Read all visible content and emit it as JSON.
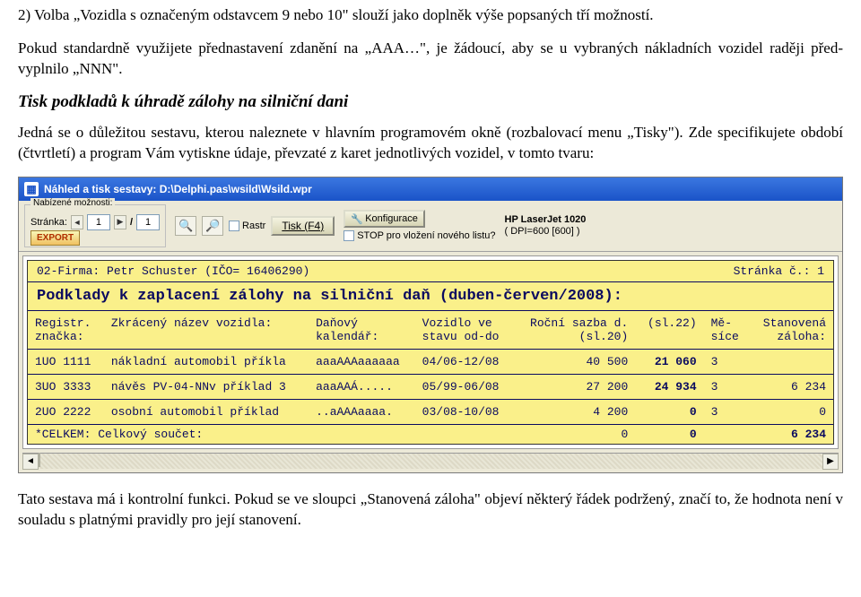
{
  "doc": {
    "item_num": "2)",
    "item_text": "Volba „Vozidla s označeným odstavcem 9 nebo 10\" slouží jako doplněk výše popsaných tří možností.",
    "para1": "Pokud standardně využijete přednastavení zdanění na „AAA…\", je žádoucí, aby se u vybraných nákladních vozidel raději před-vyplnilo „NNN\".",
    "heading": "Tisk podkladů k úhradě zálohy na silniční dani",
    "para2": "Jedná se o důležitou sestavu, kterou naleznete v hlavním programovém okně (rozbalovací menu „Tisky\"). Zde specifikujete období (čtvrtletí) a program Vám vytiskne údaje, převzaté z karet jednotlivých vozidel, v tomto tvaru:",
    "para3": "Tato sestava má i kontrolní funkci. Pokud se ve sloupci „Stanovená záloha\" objeví některý řádek podržený, značí to, že hodnota není v souladu s platnými pravidly pro její stanovení."
  },
  "win": {
    "title": "Náhled a tisk sestavy: D:\\Delphi.pas\\wsild\\Wsild.wpr",
    "moznosti_label": "Nabízené možnosti:",
    "stranka_label": "Stránka:",
    "page_value": "1",
    "total_pages": "1",
    "export_label": "EXPORT",
    "rastr_label": "Rastr",
    "tisk_label": "Tisk (F4)",
    "konfigurace_label": "Konfigurace",
    "stop_label": "STOP pro vložení nového listu?",
    "printer_name": "HP LaserJet 1020",
    "printer_dpi": "( DPI=600 [600] )"
  },
  "sheet": {
    "firm_line": "02-Firma: Petr Schuster (IČO= 16406290)",
    "page_line": "Stránka č.: 1",
    "title": "Podklady k zaplacení zálohy na silniční daň (duben-červen/2008):",
    "headers": {
      "c1a": "Registr.",
      "c1b": "značka:",
      "c2a": "",
      "c2b": "Zkrácený název vozidla:",
      "c3a": "Daňový",
      "c3b": "kalendář:",
      "c4a": "Vozidlo ve",
      "c4b": "stavu od-do",
      "c5a": "Roční sazba d.",
      "c5b": "(sl.20)",
      "c6a": "",
      "c6b": "(sl.22)",
      "c7a": "Mě-",
      "c7b": "síce",
      "c8a": "Stanovená",
      "c8b": "záloha:"
    },
    "rows": [
      {
        "reg": "1UO 1111",
        "name": "nákladní automobil příkla",
        "kal": "aaaAAAaaaaaa",
        "stav": "04/06-12/08",
        "rs": "40 500",
        "s22": "21 060",
        "mes": "3",
        "zal": ""
      },
      {
        "reg": "3UO 3333",
        "name": "návěs PV-04-NNv příklad 3",
        "kal": "aaaAAÁ.....",
        "stav": "05/99-06/08",
        "rs": "27 200",
        "s22": "24 934",
        "mes": "3",
        "zal": "6 234"
      },
      {
        "reg": "2UO 2222",
        "name": "osobní automobil příklad",
        "kal": "..aAAAaaaa.",
        "stav": "03/08-10/08",
        "rs": "4 200",
        "s22": "0",
        "mes": "3",
        "zal": "0"
      }
    ],
    "total_label": "*CELKEM:  Celkový součet:",
    "total_s22": "0",
    "total_zal": "6 234"
  }
}
